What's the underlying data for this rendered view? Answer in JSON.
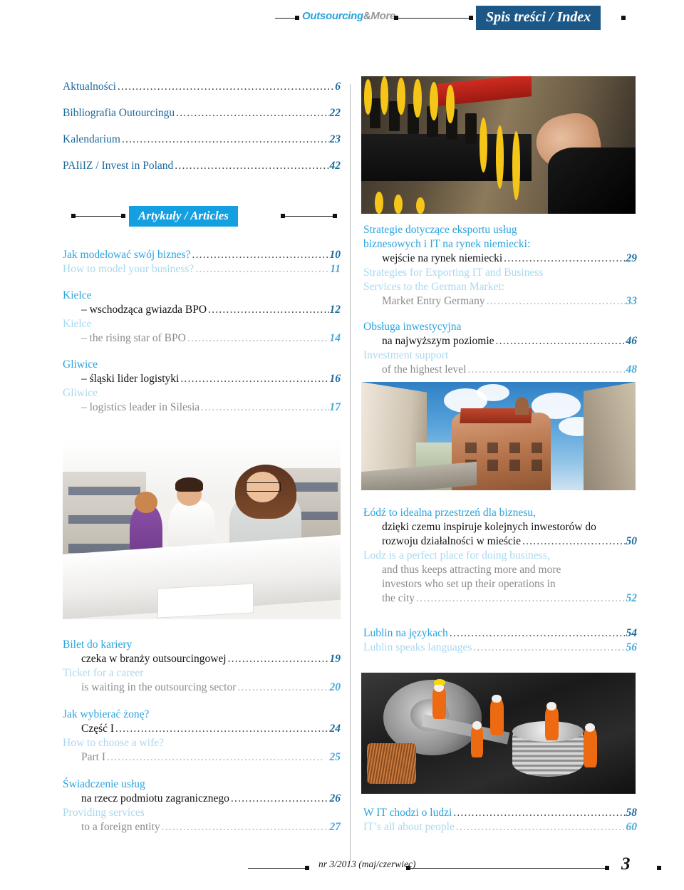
{
  "header": {
    "logo_primary": "Outsourcing",
    "logo_amp": "&",
    "logo_secondary": "More",
    "title_badge": "Spis treści / Index"
  },
  "section_badge": {
    "articles": "Artykuły / Articles"
  },
  "colors": {
    "accent_blue": "#2ba3dd",
    "badge_blue": "#14a0e0",
    "badge_dark": "#1b5887",
    "page_number_blue": "#1b6a9c",
    "english_light": "#a8d9ef",
    "english_gray": "#8b8b8b"
  },
  "left_column": {
    "top_entries": [
      {
        "text": "Aktualności",
        "page": "6"
      },
      {
        "text": "Bibliografia Outourcingu",
        "page": "22"
      },
      {
        "text": "Kalendarium",
        "page": "23"
      },
      {
        "text": "PAIiIZ / Invest in Poland",
        "page": "42"
      }
    ],
    "articles": [
      {
        "pl_head": "Jak modelować swój biznes?",
        "pl_page": "10",
        "en_head": "How to model your business?",
        "en_page": "11",
        "style": "single"
      },
      {
        "pl_head": "Kielce",
        "pl_sub": "– wschodząca gwiazda BPO",
        "pl_page": "12",
        "en_head": "Kielce",
        "en_sub": "– the rising star of BPO",
        "en_page": "14",
        "style": "two-line"
      },
      {
        "pl_head": "Gliwice",
        "pl_sub": "– śląski lider logistyki",
        "pl_page": "16",
        "en_head": "Gliwice",
        "en_sub": "– logistics leader in Silesia",
        "en_page": "17",
        "style": "two-line"
      }
    ],
    "bottom_entries": [
      {
        "pl_head": "Bilet do kariery",
        "pl_sub": "czeka w branży outsourcingowej",
        "pl_page": "19",
        "en_head": "Ticket for a career",
        "en_sub": "is waiting in the outsourcing sector",
        "en_page": "20"
      },
      {
        "pl_head": "Jak wybierać żonę?",
        "pl_sub": "Część I",
        "pl_page": "24",
        "en_head": "How to choose a wife?",
        "en_sub": "Part I",
        "en_page": "25"
      },
      {
        "pl_head": "Świadczenie usług",
        "pl_sub": "na rzecz podmiotu zagranicznego",
        "pl_page": "26",
        "en_head": "Providing services",
        "en_sub": "to a foreign entity",
        "en_page": "27"
      }
    ]
  },
  "right_column": {
    "entries": [
      {
        "pl_lines": [
          "Strategie dotyczące eksportu usług",
          "biznesowych i IT na rynek niemiecki:"
        ],
        "pl_sub": "wejście na rynek niemiecki",
        "pl_page": "29",
        "en_lines": [
          "Strategies for Exporting IT and Business",
          "Services to the German Market:"
        ],
        "en_sub": "Market Entry Germany",
        "en_page": "33"
      },
      {
        "pl_lines": [
          "Obsługa inwestycyjna"
        ],
        "pl_sub": "na najwyższym poziomie",
        "pl_page": "46",
        "en_lines": [
          "Investment support"
        ],
        "en_sub": "of the highest level",
        "en_page": "48"
      }
    ],
    "lodz": {
      "pl_head": "Łódź to idealna przestrzeń dla biznesu,",
      "pl_sub_lines": [
        "dzięki czemu inspiruje kolejnych inwestorów do",
        "rozwoju działalności w mieście"
      ],
      "pl_page": "50",
      "en_head": "Lodz is a perfect place for doing business,",
      "en_sub_lines": [
        "and thus keeps attracting more and more",
        "investors who set up their operations in",
        "the city"
      ],
      "en_page": "52"
    },
    "lublin": [
      {
        "text": "Lublin na językach",
        "page": "54",
        "lang": "pl"
      },
      {
        "text": "Lublin speaks languages",
        "page": "56",
        "lang": "en"
      }
    ],
    "it_people": [
      {
        "text": "W IT chodzi o ludzi",
        "page": "58",
        "lang": "pl"
      },
      {
        "text": "IT’s all about people",
        "page": "60",
        "lang": "en"
      }
    ]
  },
  "images": [
    {
      "name": "server-patch-panel-photo",
      "alt": "hand connecting yellow fiber optic cables in a server patch panel"
    },
    {
      "name": "city-architecture-photo",
      "alt": "historic tenement buildings under blue sky with clouds"
    },
    {
      "name": "library-students-photo",
      "alt": "three smiling students studying at a library table"
    },
    {
      "name": "hard-drive-miniatures-photo",
      "alt": "miniature worker figurines on an opened hard disk drive"
    }
  ],
  "footer": {
    "issue": "nr 3/2013 (maj/czerwiec)",
    "page_number": "3"
  }
}
